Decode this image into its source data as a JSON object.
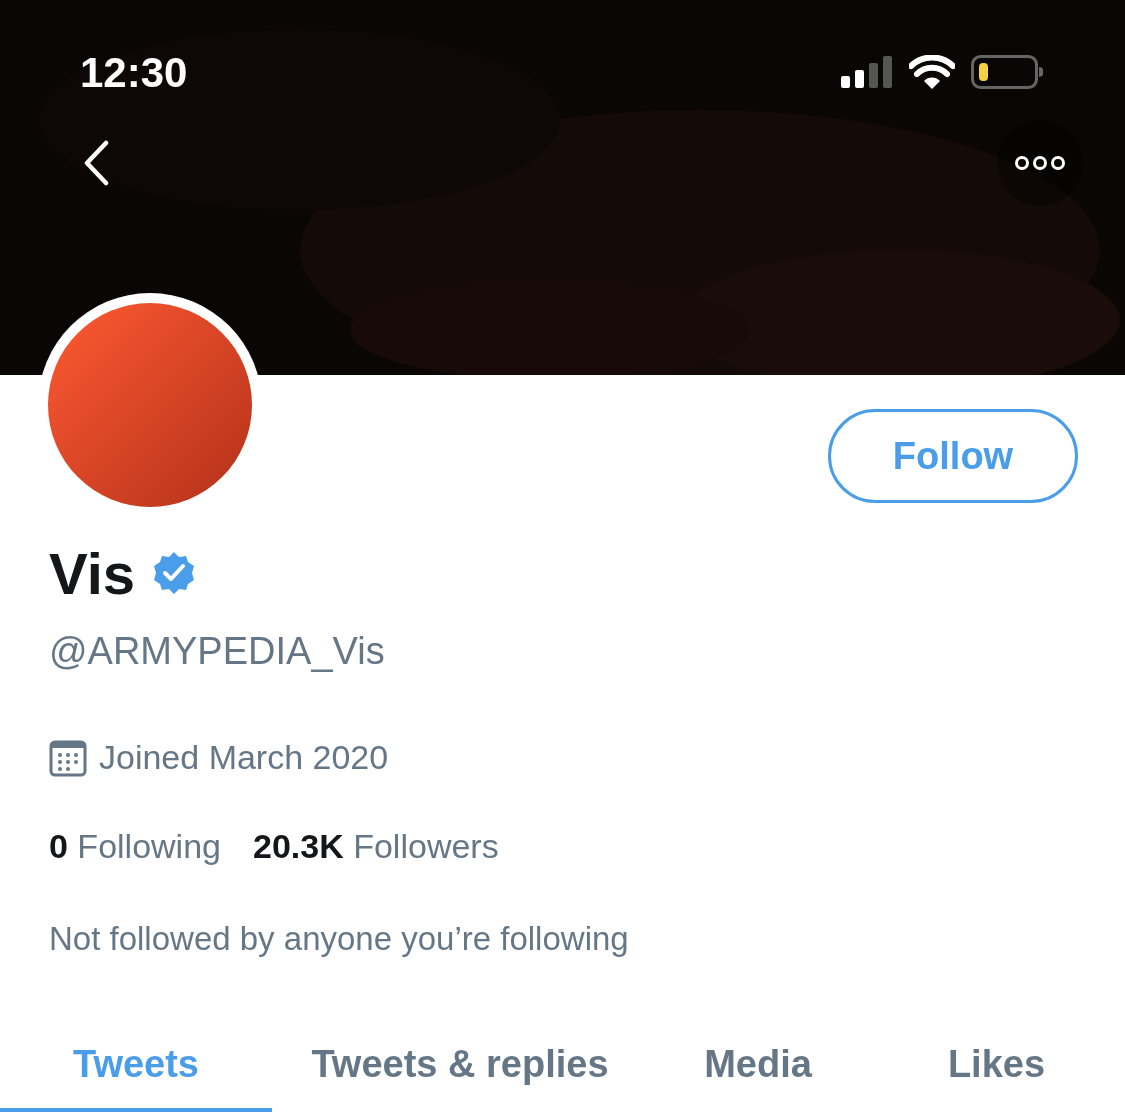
{
  "status_bar": {
    "time": "12:30"
  },
  "profile": {
    "name": "Vis",
    "verified": true,
    "handle": "@ARMYPEDIA_Vis",
    "joined": "Joined March 2020",
    "following_count": "0",
    "following_label": "Following",
    "followers_count": "20.3K",
    "followers_label": "Followers",
    "followed_by": "Not followed by anyone you’re following"
  },
  "follow_button": "Follow",
  "tabs": [
    {
      "label": "Tweets",
      "selected": true
    },
    {
      "label": "Tweets & replies",
      "selected": false
    },
    {
      "label": "Media",
      "selected": false
    },
    {
      "label": "Likes",
      "selected": false
    }
  ]
}
